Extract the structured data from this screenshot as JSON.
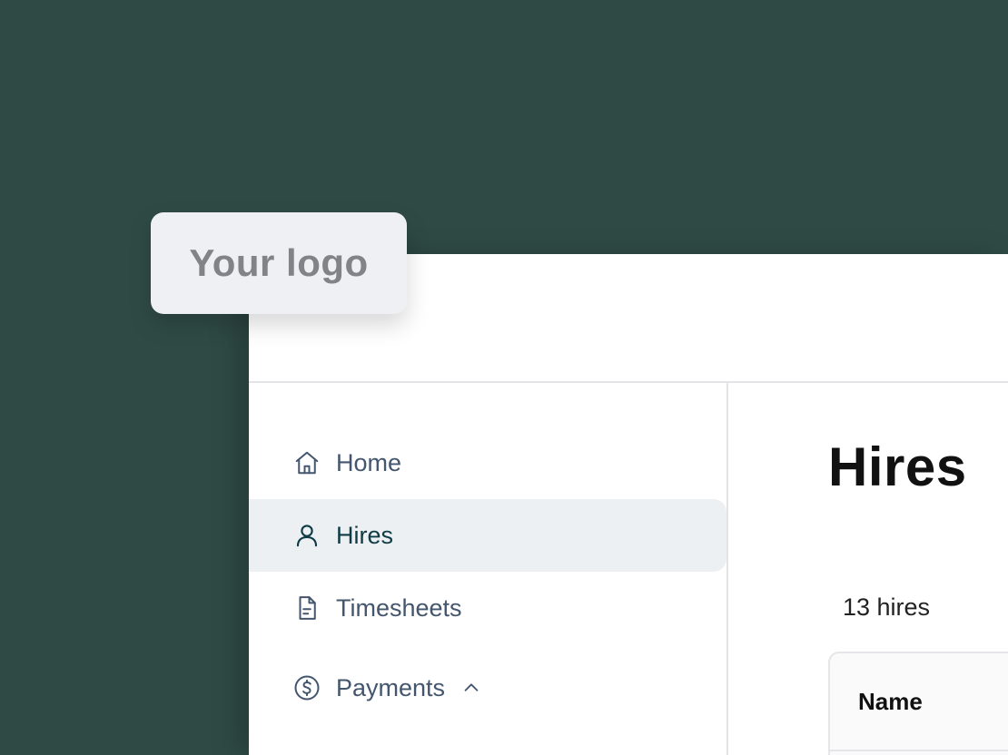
{
  "logo": {
    "text": "Your logo"
  },
  "sidebar": {
    "items": [
      {
        "label": "Home",
        "icon": "home-icon",
        "active": false
      },
      {
        "label": "Hires",
        "icon": "user-icon",
        "active": true
      },
      {
        "label": "Timesheets",
        "icon": "document-icon",
        "active": false
      },
      {
        "label": "Payments",
        "icon": "dollar-circle-icon",
        "active": false,
        "expanded": true
      }
    ]
  },
  "main": {
    "title": "Hires",
    "count_label": "13 hires",
    "table": {
      "columns": [
        "Name"
      ]
    }
  },
  "colors": {
    "background": "#2f4a45",
    "active_item_bg": "#edf0f2",
    "active_item_text": "#0e3b46",
    "nav_text": "#44566e"
  }
}
